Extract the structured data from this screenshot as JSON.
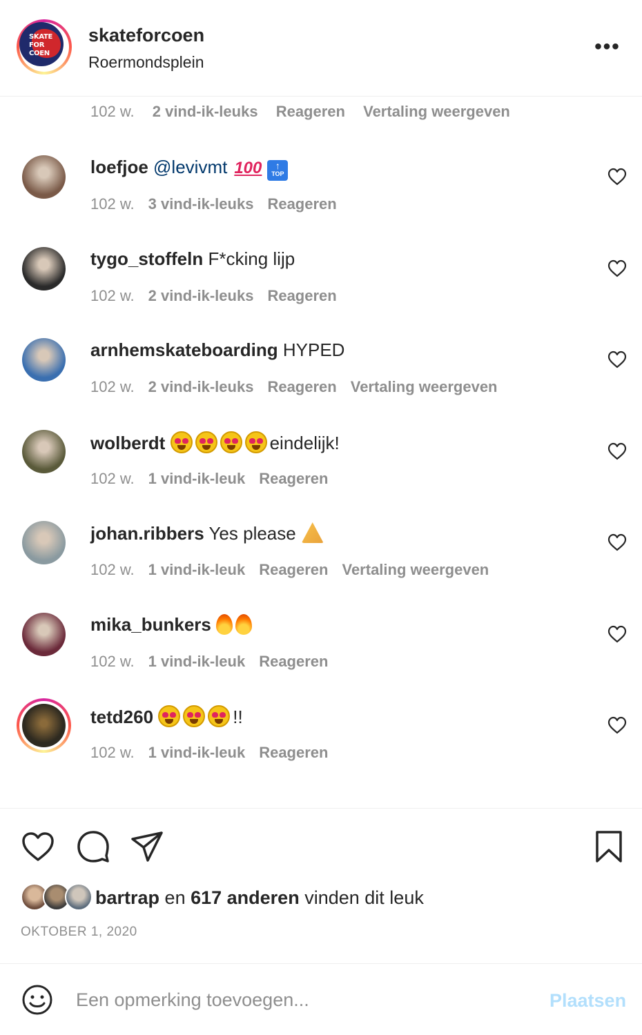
{
  "header": {
    "username": "skateforcoen",
    "location": "Roermondsplein",
    "logo_text": [
      "SKATE",
      "FOR",
      "COEN"
    ],
    "more_label": "•••"
  },
  "partial_meta": {
    "time": "102 w.",
    "likes": "2 vind-ik-leuks",
    "reply": "Reageren",
    "translate": "Vertaling weergeven"
  },
  "comments": [
    {
      "user": "loefjoe",
      "mention": "@levivmt",
      "emojis": [
        "100-emoji",
        "top-arrow-emoji"
      ],
      "text": "",
      "time": "102 w.",
      "likes": "3 vind-ik-leuks",
      "reply": "Reageren",
      "translate": "",
      "avatar_color": "#7a5a48"
    },
    {
      "user": "tygo_stoffeln",
      "mention": "",
      "emojis": [],
      "text": "F*cking lijp",
      "time": "102 w.",
      "likes": "2 vind-ik-leuks",
      "reply": "Reageren",
      "translate": "",
      "avatar_color": "#2a2a2a"
    },
    {
      "user": "arnhemskateboarding",
      "mention": "",
      "emojis": [],
      "text": "HYPED",
      "time": "102 w.",
      "likes": "2 vind-ik-leuks",
      "reply": "Reageren",
      "translate": "Vertaling weergeven",
      "avatar_color": "#3a6fb0"
    },
    {
      "user": "wolberdt",
      "mention": "",
      "emojis": [
        "heart-eyes-emoji",
        "heart-eyes-emoji",
        "heart-eyes-emoji",
        "heart-eyes-emoji"
      ],
      "text": "eindelijk!",
      "time": "102 w.",
      "likes": "1 vind-ik-leuk",
      "reply": "Reageren",
      "translate": "",
      "avatar_color": "#5a5a3a"
    },
    {
      "user": "johan.ribbers",
      "mention": "",
      "emojis": [],
      "text": "Yes please",
      "trailing_emoji": "pray-emoji",
      "time": "102 w.",
      "likes": "1 vind-ik-leuk",
      "reply": "Reageren",
      "translate": "Vertaling weergeven",
      "avatar_color": "#8a9aa0"
    },
    {
      "user": "mika_bunkers",
      "mention": "",
      "emojis": [
        "fire-emoji",
        "fire-emoji"
      ],
      "text": "",
      "time": "102 w.",
      "likes": "1 vind-ik-leuk",
      "reply": "Reageren",
      "translate": "",
      "avatar_color": "#6b2a3a"
    },
    {
      "user": "tetd260",
      "mention": "",
      "emojis": [
        "heart-eyes-emoji",
        "heart-eyes-emoji",
        "heart-eyes-emoji"
      ],
      "text": "!!",
      "time": "102 w.",
      "likes": "1 vind-ik-leuk",
      "reply": "Reageren",
      "translate": "",
      "avatar_color": "#2e2a20",
      "story_ring": true
    }
  ],
  "actions": {
    "like_icon": "heart-outline-icon",
    "comment_icon": "comment-bubble-icon",
    "share_icon": "paper-plane-icon",
    "save_icon": "bookmark-icon"
  },
  "likes_summary": {
    "user": "bartrap",
    "connector": "en",
    "count": "617 anderen",
    "suffix": "vinden dit leuk"
  },
  "post_date": "OKTOBER 1, 2020",
  "add_comment": {
    "placeholder": "Een opmerking toevoegen...",
    "post_label": "Plaatsen",
    "emoji_icon": "smiley-icon"
  },
  "colors": {
    "text": "#262626",
    "secondary": "#8e8e8e",
    "mention": "#00376b",
    "post_disabled": "#b2dffc"
  }
}
